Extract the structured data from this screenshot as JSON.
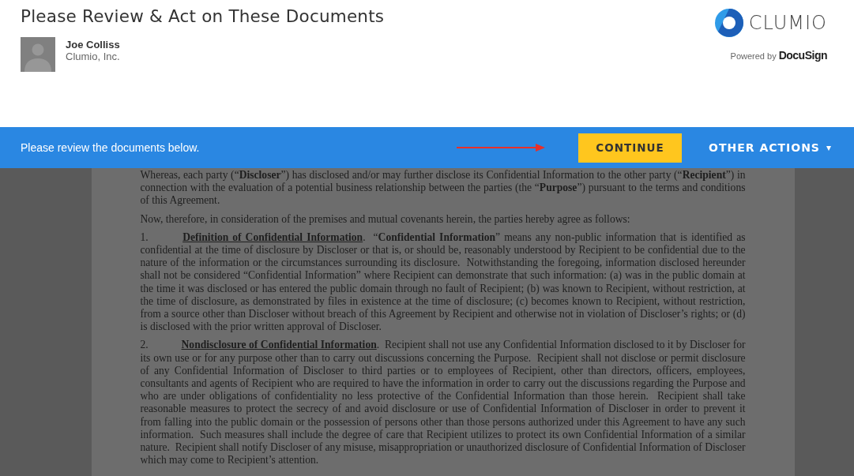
{
  "header": {
    "title": "Please Review & Act on These Documents",
    "sender": {
      "name": "Joe Colliss",
      "company": "Clumio, Inc."
    },
    "brand": {
      "name": "CLUMIO",
      "powered_by": "Powered by",
      "provider": "DocuSign"
    }
  },
  "action_bar": {
    "message": "Please review the documents below.",
    "primary_button": "CONTINUE",
    "menu_button": "OTHER ACTIONS",
    "menu_caret": "▾"
  },
  "document": {
    "paragraphs": [
      {
        "kind": "plain",
        "text": "Whereas, each party (“**Discloser**”) has disclosed and/or may further disclose its Confidential Information to the other party (“**Recipient**”) in connection with the evaluation of a potential business relationship between the parties (the “**Purpose**”) pursuant to the terms and conditions of this Agreement."
      },
      {
        "kind": "plain",
        "text": "Now, therefore, in consideration of the premises and mutual covenants herein, the parties hereby agree as follows:"
      },
      {
        "kind": "numbered",
        "text": "1.\t**Definition of Confidential Information**.  “**Confidential Information**” means any non-public information that is identified as confidential at the time of disclosure by Discloser or that is, or should be, reasonably understood by Recipient to be confidential due to the nature of the information or the circumstances surrounding its disclosure.  Notwithstanding the foregoing, information disclosed hereunder shall not be considered “Confidential Information” where Recipient can demonstrate that such information: (a) was in the public domain at the time it was disclosed or has entered the public domain through no fault of Recipient; (b) was known to Recipient, without restriction, at the time of disclosure, as demonstrated by files in existence at the time of disclosure; (c) becomes known to Recipient, without restriction, from a source other than Discloser without breach of this Agreement by Recipient and otherwise not in violation of Discloser’s rights; or (d) is disclosed with the prior written approval of Discloser."
      },
      {
        "kind": "numbered",
        "text": "2.\t**Nondisclosure of Confidential Information**.  Recipient shall not use any Confidential Information disclosed to it by Discloser for its own use or for any purpose other than to carry out discussions concerning the Purpose.  Recipient shall not disclose or permit disclosure of any Confidential Information of Discloser to third parties or to employees of Recipient, other than directors, officers, employees, consultants and agents of Recipient who are required to have the information in order to carry out the discussions regarding the Purpose and who are under obligations of confidentiality no less protective of the Confidential Information than those herein.  Recipient shall take reasonable measures to protect the secrecy of and avoid disclosure or use of Confidential Information of Discloser in order to prevent it from falling into the public domain or the possession of persons other than those persons authorized under this Agreement to have any such information.  Such measures shall include the degree of care that Recipient utilizes to protect its own Confidential Information of a similar nature.  Recipient shall notify Discloser of any misuse, misappropriation or unauthorized disclosure of Confidential Information of Discloser which may come to Recipient’s attention."
      }
    ]
  }
}
